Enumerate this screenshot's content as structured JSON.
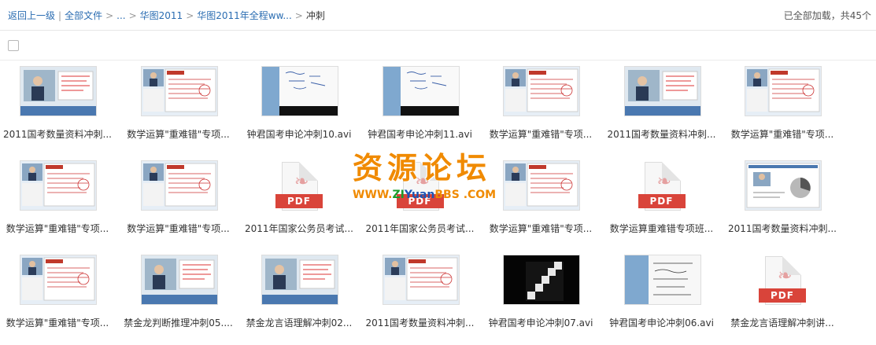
{
  "breadcrumb": {
    "back": "返回上一级",
    "all": "全部文件",
    "ellipsis": "...",
    "lvl1": "华图2011",
    "lvl2": "华图2011年全程ww...",
    "current": "冲刺"
  },
  "status": "已全部加载，共45个",
  "watermark": {
    "title": "资源论坛",
    "url_prefix": "WWW.",
    "url_zi": "ZI",
    "url_yuan": "Yuan",
    "url_suffix": "BBS .COM"
  },
  "pdf_label": "PDF",
  "files": [
    {
      "name": "2011国考数量资料冲刺...",
      "kind": "video",
      "scene": "lecture"
    },
    {
      "name": "数学运算\"重难错\"专项...",
      "kind": "video",
      "scene": "slide"
    },
    {
      "name": "钟君国考申论冲刺10.avi",
      "kind": "video",
      "scene": "board"
    },
    {
      "name": "钟君国考申论冲刺11.avi",
      "kind": "video",
      "scene": "board"
    },
    {
      "name": "数学运算\"重难错\"专项...",
      "kind": "video",
      "scene": "slide"
    },
    {
      "name": "2011国考数量资料冲刺...",
      "kind": "video",
      "scene": "lecture"
    },
    {
      "name": "数学运算\"重难错\"专项...",
      "kind": "video",
      "scene": "slide"
    },
    {
      "name": "数学运算\"重难错\"专项...",
      "kind": "video",
      "scene": "slide"
    },
    {
      "name": "数学运算\"重难错\"专项...",
      "kind": "video",
      "scene": "slide"
    },
    {
      "name": "2011年国家公务员考试...",
      "kind": "pdf"
    },
    {
      "name": "2011年国家公务员考试...",
      "kind": "pdf"
    },
    {
      "name": "数学运算\"重难错\"专项...",
      "kind": "video",
      "scene": "slide"
    },
    {
      "name": "数学运算重难错专项班...",
      "kind": "pdf"
    },
    {
      "name": "2011国考数量资料冲刺...",
      "kind": "video",
      "scene": "chart"
    },
    {
      "name": "数学运算\"重难错\"专项...",
      "kind": "video",
      "scene": "slide"
    },
    {
      "name": "禁金龙判断推理冲刺05....",
      "kind": "video",
      "scene": "lecture"
    },
    {
      "name": "禁金龙言语理解冲刺02...",
      "kind": "video",
      "scene": "lecture"
    },
    {
      "name": "2011国考数量资料冲刺...",
      "kind": "video",
      "scene": "slide"
    },
    {
      "name": "钟君国考申论冲刺07.avi",
      "kind": "video",
      "scene": "dark"
    },
    {
      "name": "钟君国考申论冲刺06.avi",
      "kind": "video",
      "scene": "whiteboard"
    },
    {
      "name": "禁金龙言语理解冲刺讲...",
      "kind": "pdf"
    }
  ]
}
